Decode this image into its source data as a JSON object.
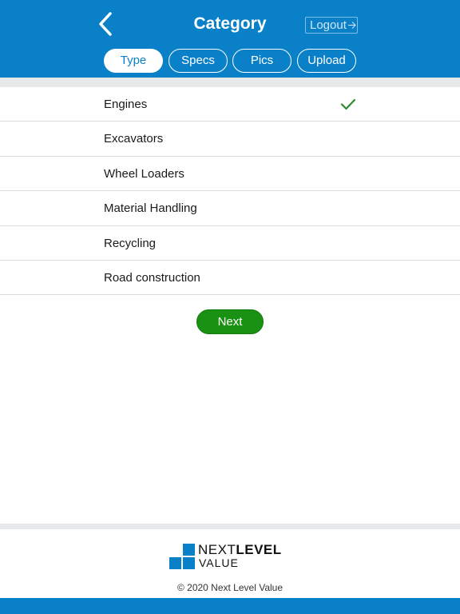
{
  "header": {
    "title": "Category",
    "logout_label": "Logout",
    "back_icon": "chevron-left-icon",
    "logout_icon": "arrow-right-icon"
  },
  "tabs": [
    {
      "label": "Type",
      "active": true
    },
    {
      "label": "Specs",
      "active": false
    },
    {
      "label": "Pics",
      "active": false
    },
    {
      "label": "Upload",
      "active": false
    }
  ],
  "categories": [
    {
      "label": "Engines",
      "selected": true
    },
    {
      "label": "Excavators",
      "selected": false
    },
    {
      "label": "Wheel Loaders",
      "selected": false
    },
    {
      "label": "Material Handling",
      "selected": false
    },
    {
      "label": "Recycling",
      "selected": false
    },
    {
      "label": "Road construction",
      "selected": false
    }
  ],
  "next_label": "Next",
  "footer": {
    "logo_next": "NEXT",
    "logo_level": "LEVEL",
    "logo_value": "VALUE",
    "copyright": "© 2020 Next Level Value"
  },
  "colors": {
    "brand_blue": "#0a80c8",
    "next_green": "#199112",
    "check_green": "#2e8b2e"
  }
}
